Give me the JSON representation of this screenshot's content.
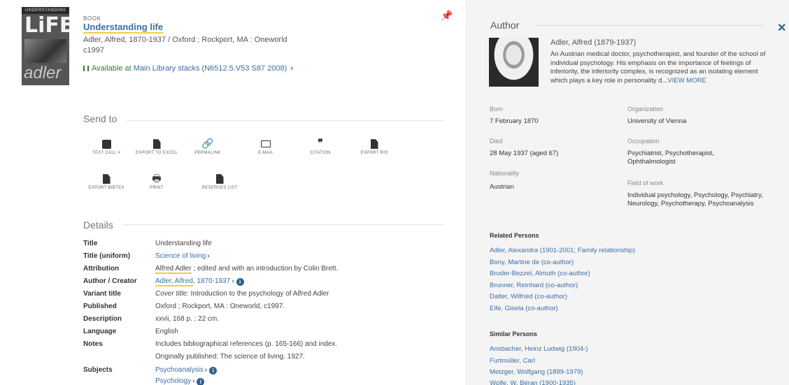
{
  "record": {
    "type": "BOOK",
    "title": "Understanding life",
    "author_line": "Adler, Alfred, 1870-1937 / Oxford ; Rockport, MA : Oneworld",
    "year": "c1997",
    "availability_prefix": "Available at",
    "availability_location": "Main Library stacks (N6512.5.V53 S87 2008)",
    "cover": {
      "top": "UNDERSTANDING",
      "big": "LiFE",
      "bottom": "adler"
    }
  },
  "send_to": {
    "title": "Send to",
    "actions": [
      {
        "label": "TEXT CALL #",
        "icon": "chat-icon"
      },
      {
        "label": "EXPORT TO EXCEL",
        "icon": "excel-icon"
      },
      {
        "label": "PERMALINK",
        "icon": "link-icon"
      },
      {
        "label": "E-MAIL",
        "icon": "mail-icon"
      },
      {
        "label": "CITATION",
        "icon": "quote-icon"
      },
      {
        "label": "EXPORT RIS",
        "icon": "file-icon"
      },
      {
        "label": "EXPORT BIBTEX",
        "icon": "file-icon"
      },
      {
        "label": "PRINT",
        "icon": "print-icon"
      },
      {
        "label": "RESERVES LIST",
        "icon": "file-icon"
      }
    ]
  },
  "details": {
    "title": "Details",
    "rows": {
      "title": {
        "label": "Title",
        "value": "Understanding life"
      },
      "uniform": {
        "label": "Title (uniform)",
        "value": "Science of living"
      },
      "attribution": {
        "label": "Attribution",
        "name": "Alfred Adler",
        "rest": " ; edited and with an introduction by Colin Brett."
      },
      "author": {
        "label": "Author / Creator",
        "name": "Adler, Alfred",
        "dates": ", 1870-1937"
      },
      "variant": {
        "label": "Variant title",
        "prefix": "Cover title:",
        "value": " Introduction to the psychology of Alfred Adler"
      },
      "published": {
        "label": "Published",
        "value": "Oxford ; Rockport, MA : Oneworld, c1997."
      },
      "description": {
        "label": "Description",
        "value": "xxvii, 168 p. ; 22 cm."
      },
      "language": {
        "label": "Language",
        "value": "English"
      },
      "notes": {
        "label": "Notes",
        "value1": "Includes bibliographical references (p. 165-166) and index.",
        "value2": "Originally published: The science of living. 1927."
      },
      "subjects": {
        "label": "Subjects",
        "value1": "Psychoanalysis",
        "value2": "Psychology"
      }
    }
  },
  "author_panel": {
    "title": "Author",
    "name": "Adler, Alfred (1879-1937)",
    "description": "An Austrian medical doctor, psychotherapist, and founder of the school of individual psychology. His emphasis on the importance of feelings of inferiority, the inferiority complex, is recognized as an isolating element which plays a key role in personality d...",
    "view_more": "VIEW MORE",
    "born_label": "Born",
    "born": "7 February 1870",
    "died_label": "Died",
    "died": "28 May 1937 (aged 67)",
    "nationality_label": "Nationality",
    "nationality": "Austrian",
    "organization_label": "Organization",
    "organization": "University of Vienna",
    "occupation_label": "Occupation",
    "occupation": "Psychiatrist, Psychotherapist, Ophthalmologist",
    "field_label": "Field of work",
    "field": "Individual psychology, Psychology, Psychiatry, Neurology, Psychotherapy, Psychoanalysis",
    "related_title": "Related Persons",
    "related": [
      "Adler, Alexandra (1901-2001; Family relationship)",
      "Bony, Martine de (co-author)",
      "Bruder-Bezzel, Almuth (co-author)",
      "Brunner, Reinhard (co-author)",
      "Datler, Wilfried (co-author)",
      "Eife, Gisela (co-author)"
    ],
    "similar_title": "Similar Persons",
    "similar": [
      "Ansbacher, Heinz Ludwig (1904-)",
      "Furtmüller, Carl",
      "Metzger, Wolfgang (1899-1979)",
      "Wolfe, W. Béran (1900-1935)"
    ]
  }
}
